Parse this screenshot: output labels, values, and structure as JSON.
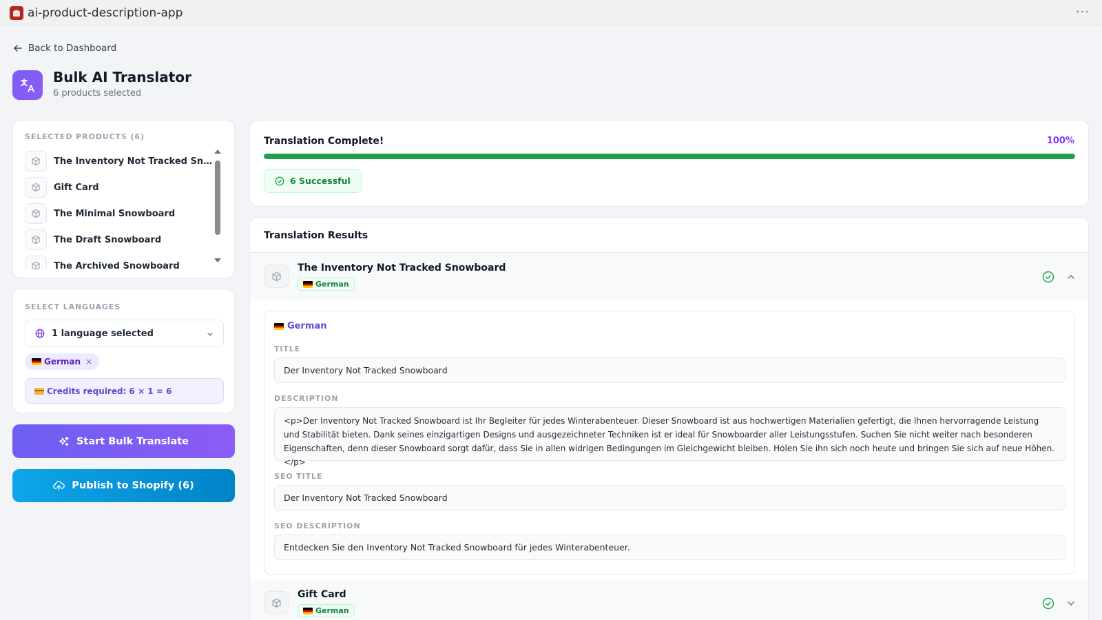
{
  "app": {
    "title": "ai-product-description-app"
  },
  "nav": {
    "back_label": "Back to Dashboard"
  },
  "header": {
    "title": "Bulk AI Translator",
    "subtitle": "6 products selected"
  },
  "products": {
    "label": "SELECTED PRODUCTS (6)",
    "items": [
      {
        "name": "The Inventory Not Tracked Snowboard"
      },
      {
        "name": "Gift Card"
      },
      {
        "name": "The Minimal Snowboard"
      },
      {
        "name": "The Draft Snowboard"
      },
      {
        "name": "The Archived Snowboard"
      }
    ]
  },
  "languages": {
    "label": "SELECT LANGUAGES",
    "select_value": "1 language selected",
    "chip": "German",
    "credits": "Credits required: 6 × 1 = 6"
  },
  "buttons": {
    "translate": "Start Bulk Translate",
    "publish": "Publish to Shopify (6)"
  },
  "progress": {
    "title": "Translation Complete!",
    "percent_label": "100%",
    "percent": 100,
    "success_label": "6 Successful"
  },
  "results": {
    "title": "Translation Results",
    "items": [
      {
        "name": "The Inventory Not Tracked Snowboard",
        "language": "German",
        "expanded": true,
        "fields": {
          "title_label": "TITLE",
          "title": "Der Inventory Not Tracked Snowboard",
          "description_label": "DESCRIPTION",
          "description": "<p>Der Inventory Not Tracked Snowboard ist Ihr Begleiter für jedes Winterabenteuer. Dieser Snowboard ist aus hochwertigen Materialien gefertigt, die Ihnen hervorragende Leistung und Stabilität bieten. Dank seines einzigartigen Designs und ausgezeichneter Techniken ist er ideal für Snowboarder aller Leistungsstufen. Suchen Sie nicht weiter nach besonderen Eigenschaften, denn dieser Snowboard sorgt dafür, dass Sie in allen widrigen Bedingungen im Gleichgewicht bleiben. Holen Sie ihn sich noch heute und bringen Sie sich auf neue Höhen.</p>",
          "seo_title_label": "SEO TITLE",
          "seo_title": "Der Inventory Not Tracked Snowboard",
          "seo_description_label": "SEO DESCRIPTION",
          "seo_description": "Entdecken Sie den Inventory Not Tracked Snowboard für jedes Winterabenteuer."
        }
      },
      {
        "name": "Gift Card",
        "language": "German",
        "expanded": false
      }
    ]
  },
  "colors": {
    "accent": "#7c5cf6",
    "success": "#1fa04a",
    "publish": "#0ea5e9"
  }
}
